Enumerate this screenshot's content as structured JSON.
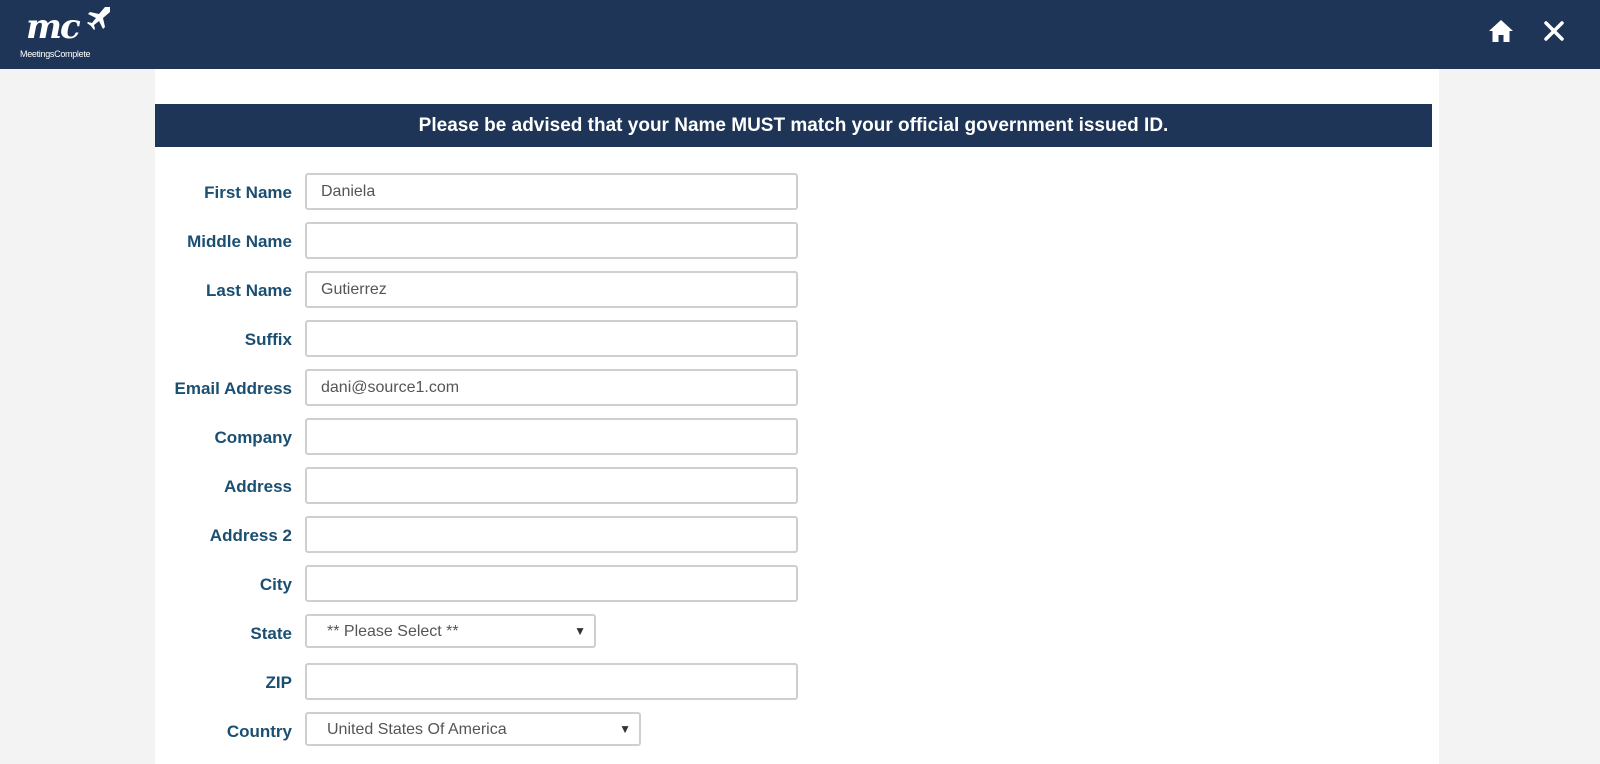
{
  "header": {
    "logo_text": "mc",
    "brand_name": "MeetingsComplete",
    "home_icon": "home-icon",
    "close_icon": "close-icon",
    "background_color": "#1e3557"
  },
  "notice": {
    "text": "Please be advised that your Name MUST match your official government issued ID."
  },
  "form": {
    "first_name": {
      "label": "First Name",
      "value": "Daniela"
    },
    "middle_name": {
      "label": "Middle Name",
      "value": ""
    },
    "last_name": {
      "label": "Last Name",
      "value": "Gutierrez"
    },
    "suffix": {
      "label": "Suffix",
      "value": ""
    },
    "email": {
      "label": "Email Address",
      "value": "dani@source1.com"
    },
    "company": {
      "label": "Company",
      "value": ""
    },
    "address": {
      "label": "Address",
      "value": ""
    },
    "address2": {
      "label": "Address 2",
      "value": ""
    },
    "city": {
      "label": "City",
      "value": ""
    },
    "state": {
      "label": "State",
      "selected": "** Please Select **"
    },
    "zip": {
      "label": "ZIP",
      "value": ""
    },
    "country": {
      "label": "Country",
      "selected": "United States Of America"
    }
  },
  "colors": {
    "label_color": "#1b4f72",
    "page_background": "#f3f3f3"
  }
}
